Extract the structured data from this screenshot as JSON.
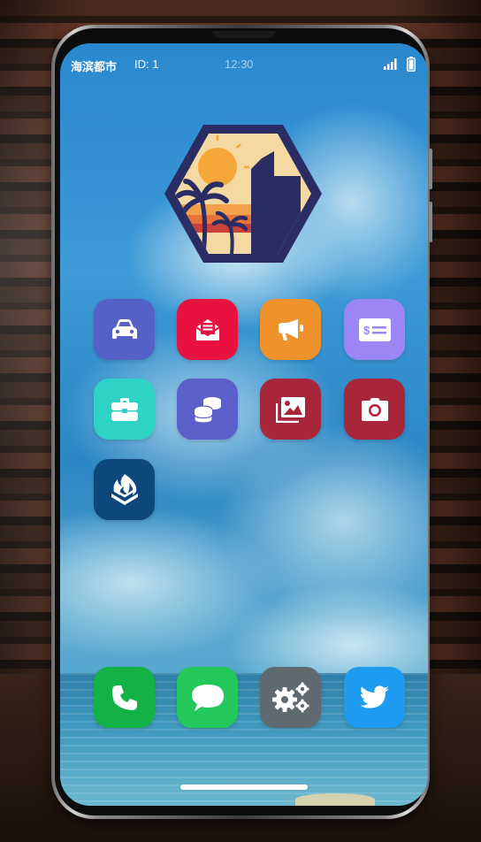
{
  "statusbar": {
    "city": "海滨都市",
    "id": "ID: 1",
    "time": "12:30"
  },
  "colors": {
    "garage": "#5560c8",
    "mail": "#e8113f",
    "ads": "#f0922b",
    "bank": "#9b86f4",
    "jobs": "#2fd3c6",
    "crypto": "#5a5fc9",
    "gallery": "#a8263a",
    "camera": "#a8263a",
    "fire": "#0d477c",
    "phone": "#12b344",
    "messages": "#24c75a",
    "settings": "#5f6970",
    "twitter": "#1d9bf0"
  },
  "apps": [
    {
      "name": "garage",
      "icon": "car-icon"
    },
    {
      "name": "mail",
      "icon": "envelope-icon"
    },
    {
      "name": "ads",
      "icon": "megaphone-icon"
    },
    {
      "name": "bank",
      "icon": "money-check-icon"
    },
    {
      "name": "jobs",
      "icon": "briefcase-icon"
    },
    {
      "name": "crypto",
      "icon": "coins-icon"
    },
    {
      "name": "gallery",
      "icon": "images-icon"
    },
    {
      "name": "camera",
      "icon": "camera-icon"
    },
    {
      "name": "fire",
      "icon": "fire-department-icon"
    }
  ],
  "dock": [
    {
      "name": "phone",
      "icon": "phone-icon"
    },
    {
      "name": "messages",
      "icon": "chat-bubble-icon"
    },
    {
      "name": "settings",
      "icon": "gears-icon"
    },
    {
      "name": "twitter",
      "icon": "twitter-bird-icon"
    }
  ]
}
